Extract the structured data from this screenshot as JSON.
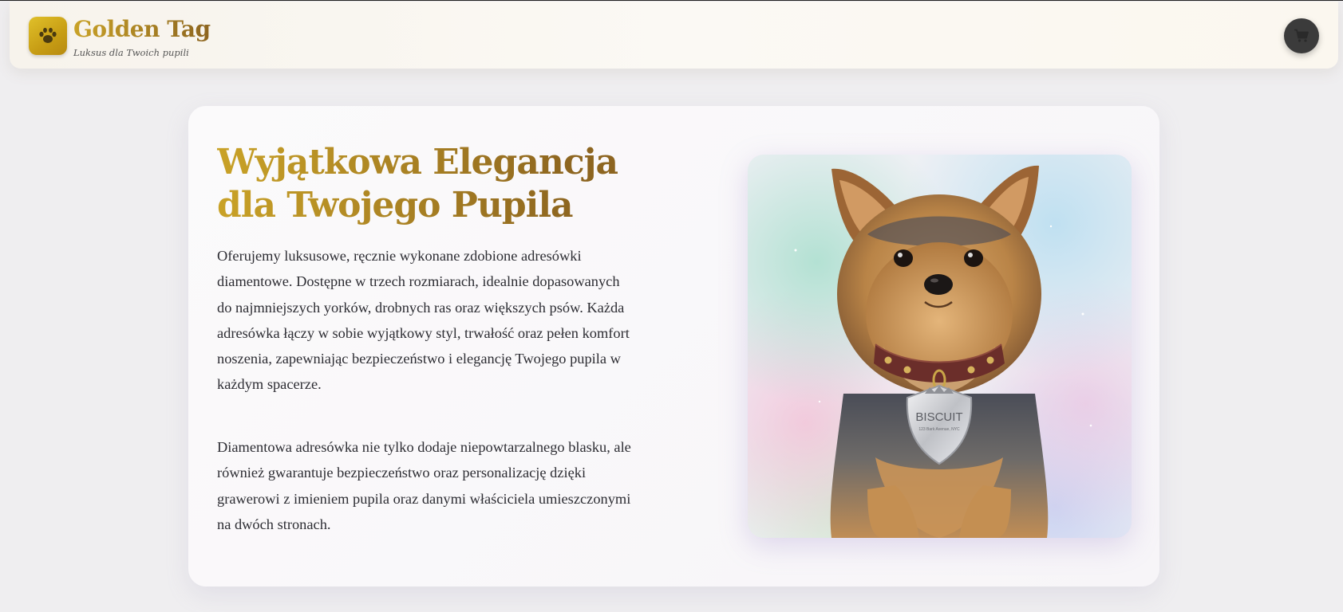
{
  "header": {
    "brand_title": "Golden Tag",
    "tagline": "Luksus dla Twoich pupili",
    "logo_icon": "paw-icon",
    "cart_icon": "cart-icon"
  },
  "hero": {
    "title": "Wyjątkowa Elegancja dla Twojego Pupila",
    "paragraph_1": "Oferujemy luksusowe, ręcznie wykonane zdobione adresówki diamentowe. Dostępne w trzech rozmiarach, idealnie dopasowanych do najmniejszych yorków, drobnych ras oraz większych psów. Każda adresówka łączy w sobie wyjątkowy styl, trwałość oraz pełen komfort noszenia, zapewniając bezpieczeństwo i elegancję Twojego pupila w każdym spacerze.",
    "paragraph_2": "Diamentowa adresówka nie tylko dodaje niepowtarzalnego blasku, ale również gwarantuje bezpieczeństwo oraz personalizację dzięki grawerowi z imieniem pupila oraz danymi właściciela umieszczonymi na dwóch stronach.",
    "image": {
      "tag_name": "BISCUIT",
      "tag_subtext": "123 Bark Avenue, NYC"
    }
  },
  "colors": {
    "gold_light": "#c9a227",
    "gold_dark": "#8d6520",
    "cart_bg": "#3b3b3b"
  }
}
